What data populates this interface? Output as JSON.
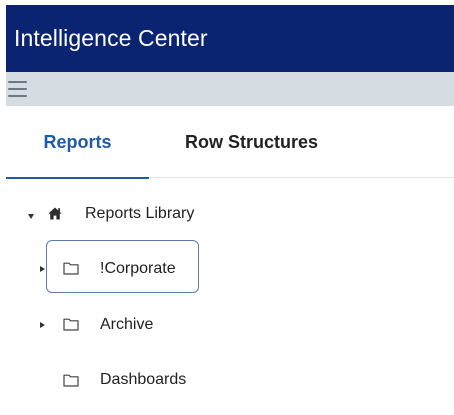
{
  "app": {
    "title": "Intelligence Center"
  },
  "toolbar": {
    "menu_icon": "hamburger-menu-icon"
  },
  "tabs": [
    {
      "label": "Reports",
      "active": true
    },
    {
      "label": "Row Structures",
      "active": false
    }
  ],
  "tree": {
    "root": {
      "label": "Reports Library",
      "icon": "home-icon",
      "expanded": true
    },
    "items": [
      {
        "label": "!Corporate",
        "icon": "folder-icon",
        "has_children": true,
        "selected": true
      },
      {
        "label": "Archive",
        "icon": "folder-icon",
        "has_children": true,
        "selected": false
      },
      {
        "label": "Dashboards",
        "icon": "folder-icon",
        "has_children": false,
        "selected": false
      }
    ]
  },
  "colors": {
    "header": "#0a2472",
    "toolbar": "#d5dde3",
    "active_tab": "#1e5aa8"
  }
}
